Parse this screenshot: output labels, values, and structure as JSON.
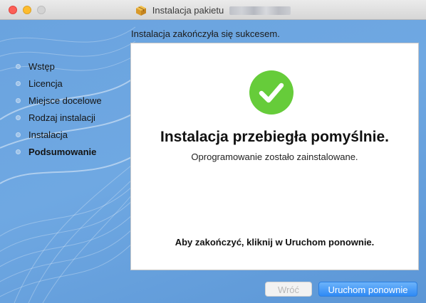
{
  "window": {
    "title": "Instalacja pakietu",
    "title_obscured": true
  },
  "sidebar": {
    "steps": [
      {
        "label": "Wstęp",
        "active": false
      },
      {
        "label": "Licencja",
        "active": false
      },
      {
        "label": "Miejsce docelowe",
        "active": false
      },
      {
        "label": "Rodzaj instalacji",
        "active": false
      },
      {
        "label": "Instalacja",
        "active": false
      },
      {
        "label": "Podsumowanie",
        "active": true
      }
    ]
  },
  "main": {
    "status": "Instalacja zakończyła się sukcesem.",
    "heading": "Instalacja przebiegła pomyślnie.",
    "subtitle": "Oprogramowanie zostało zainstalowane.",
    "instruction": "Aby zakończyć, kliknij w Uruchom ponownie."
  },
  "buttons": {
    "back": {
      "label": "Wróć",
      "enabled": false
    },
    "restart": {
      "label": "Uruchom ponownie",
      "enabled": true
    }
  },
  "colors": {
    "accent": "#2f8af5",
    "success": "#66cc3a",
    "sidebar": "#6aa3df"
  }
}
